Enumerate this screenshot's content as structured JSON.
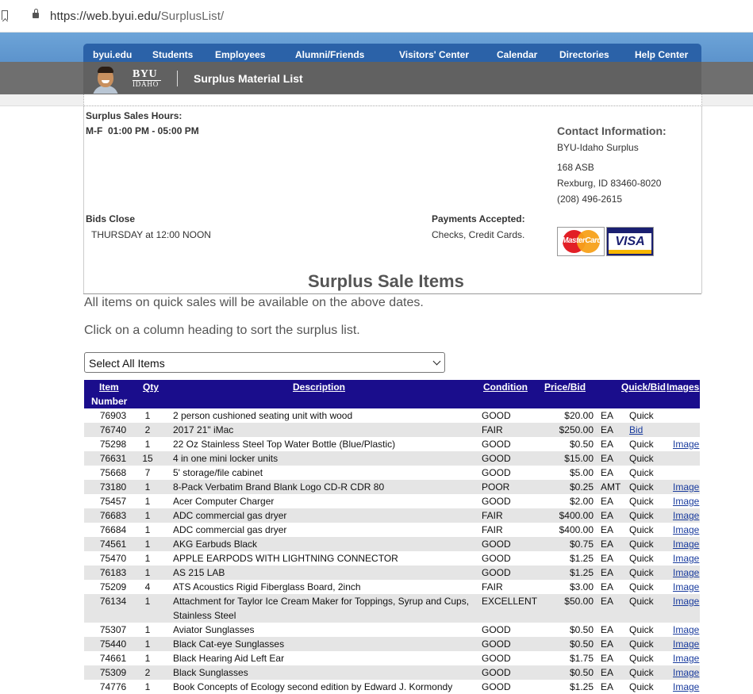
{
  "browser": {
    "url_host": "https://web.byui.edu/",
    "url_path": "SurplusList/"
  },
  "nav": [
    "byui.edu",
    "Students",
    "Employees",
    "Alumni/Friends",
    "Visitors' Center",
    "Calendar",
    "Directories",
    "Help Center"
  ],
  "header": {
    "logo_main": "BYU",
    "logo_sub": "IDAHO",
    "title": "Surplus Material List"
  },
  "info": {
    "hours_label": "Surplus Sales Hours:",
    "hours_value": "M-F  01:00 PM - 05:00 PM",
    "bids_label": "Bids Close",
    "bids_value": "THURSDAY at 12:00 NOON",
    "payments_label": "Payments Accepted:",
    "payments_value": "Checks, Credit Cards.",
    "contact_heading": "Contact Information:",
    "contact_lines": [
      "BYU-Idaho Surplus",
      "168 ASB",
      "Rexburg, ID 83460-8020",
      "(208) 496-2615"
    ],
    "mastercard_label": "MasterCard",
    "visa_label": "VISA"
  },
  "section": {
    "title": "Surplus Sale Items",
    "note1": "All items on quick sales will be available on the above dates.",
    "note2": "Click on a column heading to sort the surplus list.",
    "select_value": "Select All Items"
  },
  "table": {
    "headers": {
      "item": "Item",
      "number": "Number",
      "qty": "Qty",
      "description": "Description",
      "condition": "Condition",
      "price": "Price/Bid",
      "quick": "Quick/Bid",
      "images": "Images"
    },
    "rows": [
      {
        "num": "76903",
        "qty": "1",
        "desc": "2 person cushioned seating unit with wood",
        "cond": "GOOD",
        "price": "$20.00",
        "unit": "EA",
        "quick": "Quick",
        "img": ""
      },
      {
        "num": "76740",
        "qty": "2",
        "desc": "2017 21\" iMac",
        "cond": "FAIR",
        "price": "$250.00",
        "unit": "EA",
        "quick": "Bid",
        "img": ""
      },
      {
        "num": "75298",
        "qty": "1",
        "desc": "22 Oz Stainless Steel Top Water Bottle (Blue/Plastic)",
        "cond": "GOOD",
        "price": "$0.50",
        "unit": "EA",
        "quick": "Quick",
        "img": "Image"
      },
      {
        "num": "76631",
        "qty": "15",
        "desc": "4 in one mini locker units",
        "cond": "GOOD",
        "price": "$15.00",
        "unit": "EA",
        "quick": "Quick",
        "img": ""
      },
      {
        "num": "75668",
        "qty": "7",
        "desc": "5' storage/file cabinet",
        "cond": "GOOD",
        "price": "$5.00",
        "unit": "EA",
        "quick": "Quick",
        "img": ""
      },
      {
        "num": "73180",
        "qty": "1",
        "desc": "8-Pack Verbatim Brand Blank Logo CD-R CDR 80",
        "cond": "POOR",
        "price": "$0.25",
        "unit": "AMT",
        "quick": "Quick",
        "img": "Image"
      },
      {
        "num": "75457",
        "qty": "1",
        "desc": "Acer Computer Charger",
        "cond": "GOOD",
        "price": "$2.00",
        "unit": "EA",
        "quick": "Quick",
        "img": "Image"
      },
      {
        "num": "76683",
        "qty": "1",
        "desc": "ADC commercial gas dryer",
        "cond": "FAIR",
        "price": "$400.00",
        "unit": "EA",
        "quick": "Quick",
        "img": "Image"
      },
      {
        "num": "76684",
        "qty": "1",
        "desc": "ADC commercial gas dryer",
        "cond": "FAIR",
        "price": "$400.00",
        "unit": "EA",
        "quick": "Quick",
        "img": "Image"
      },
      {
        "num": "74561",
        "qty": "1",
        "desc": "AKG Earbuds Black",
        "cond": "GOOD",
        "price": "$0.75",
        "unit": "EA",
        "quick": "Quick",
        "img": "Image"
      },
      {
        "num": "75470",
        "qty": "1",
        "desc": "APPLE EARPODS WITH LIGHTNING CONNECTOR",
        "cond": "GOOD",
        "price": "$1.25",
        "unit": "EA",
        "quick": "Quick",
        "img": "Image"
      },
      {
        "num": "76183",
        "qty": "1",
        "desc": "AS 215 LAB",
        "cond": "GOOD",
        "price": "$1.25",
        "unit": "EA",
        "quick": "Quick",
        "img": "Image"
      },
      {
        "num": "75209",
        "qty": "4",
        "desc": "ATS Acoustics Rigid Fiberglass Board, 2inch",
        "cond": "FAIR",
        "price": "$3.00",
        "unit": "EA",
        "quick": "Quick",
        "img": "Image"
      },
      {
        "num": "76134",
        "qty": "1",
        "desc": "Attachment for Taylor Ice Cream Maker for Toppings, Syrup and Cups, Stainless Steel",
        "cond": "EXCELLENT",
        "price": "$50.00",
        "unit": "EA",
        "quick": "Quick",
        "img": "Image"
      },
      {
        "num": "75307",
        "qty": "1",
        "desc": "Aviator Sunglasses",
        "cond": "GOOD",
        "price": "$0.50",
        "unit": "EA",
        "quick": "Quick",
        "img": "Image"
      },
      {
        "num": "75440",
        "qty": "1",
        "desc": "Black Cat-eye Sunglasses",
        "cond": "GOOD",
        "price": "$0.50",
        "unit": "EA",
        "quick": "Quick",
        "img": "Image"
      },
      {
        "num": "74661",
        "qty": "1",
        "desc": "Black Hearing Aid Left Ear",
        "cond": "GOOD",
        "price": "$1.75",
        "unit": "EA",
        "quick": "Quick",
        "img": "Image"
      },
      {
        "num": "75309",
        "qty": "2",
        "desc": "Black Sunglasses",
        "cond": "GOOD",
        "price": "$0.50",
        "unit": "EA",
        "quick": "Quick",
        "img": "Image"
      },
      {
        "num": "74776",
        "qty": "1",
        "desc": "Book Concepts of Ecology second edition by Edward J. Kormondy",
        "cond": "GOOD",
        "price": "$1.25",
        "unit": "EA",
        "quick": "Quick",
        "img": "Image"
      }
    ]
  }
}
